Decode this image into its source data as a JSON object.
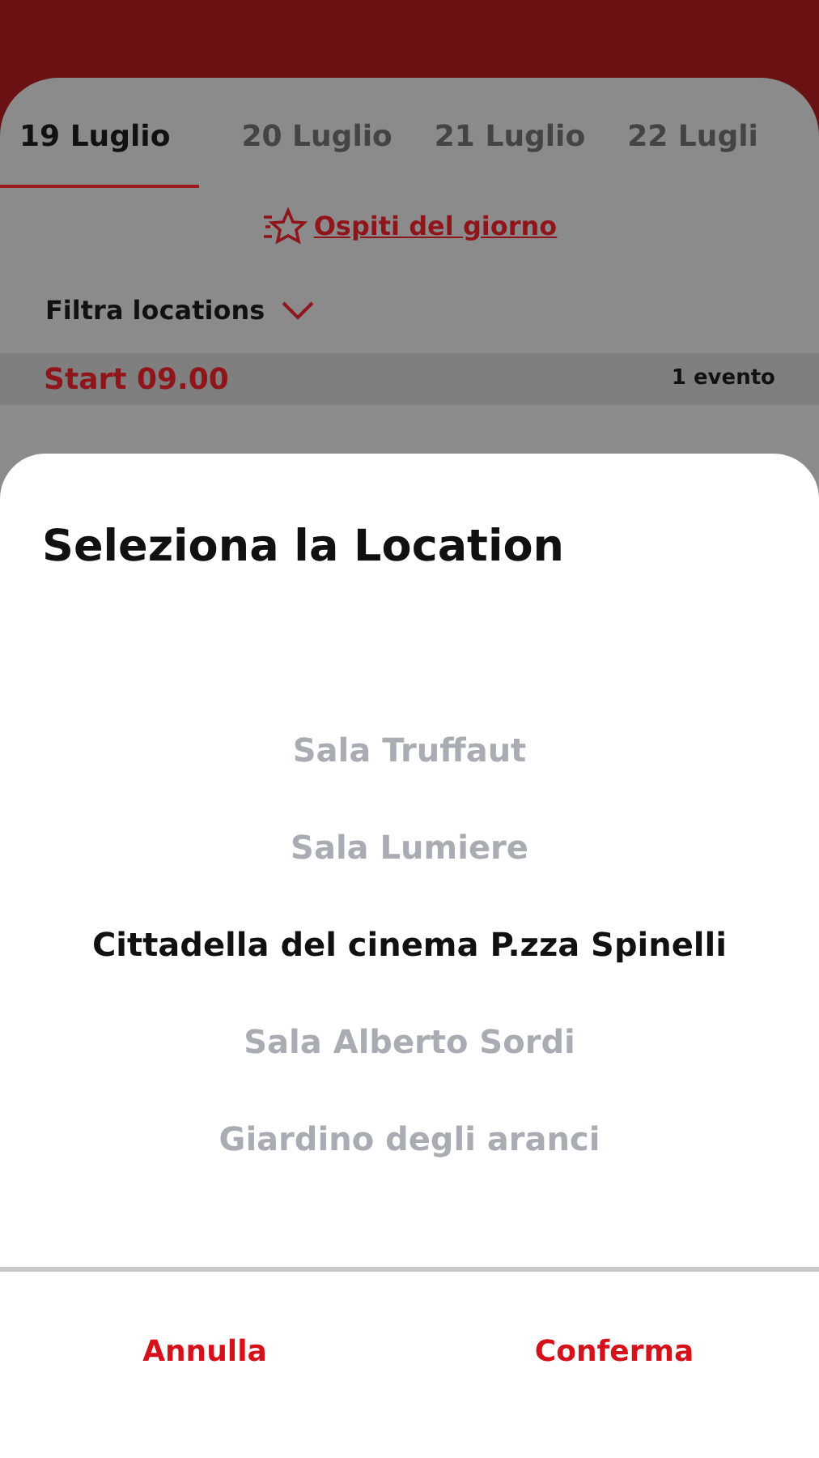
{
  "tabs": [
    {
      "label": "19 Luglio",
      "selected": true
    },
    {
      "label": "20 Luglio",
      "selected": false
    },
    {
      "label": "21 Luglio",
      "selected": false
    },
    {
      "label": "22 Lugli",
      "selected": false
    }
  ],
  "guests_link": "Ospiti del giorno",
  "filter": {
    "label": "Filtra locations"
  },
  "section": {
    "title": "Start 09.00",
    "count": "1 evento"
  },
  "sheet": {
    "title": "Seleziona la Location",
    "options": [
      {
        "label": "Sala Truffaut",
        "selected": false
      },
      {
        "label": "Sala Lumiere",
        "selected": false
      },
      {
        "label": "Cittadella del cinema P.zza Spinelli",
        "selected": true
      },
      {
        "label": "Sala Alberto Sordi",
        "selected": false
      },
      {
        "label": "Giardino degli aranci",
        "selected": false
      }
    ],
    "buttons": [
      "Annulla",
      "Conferma"
    ]
  }
}
